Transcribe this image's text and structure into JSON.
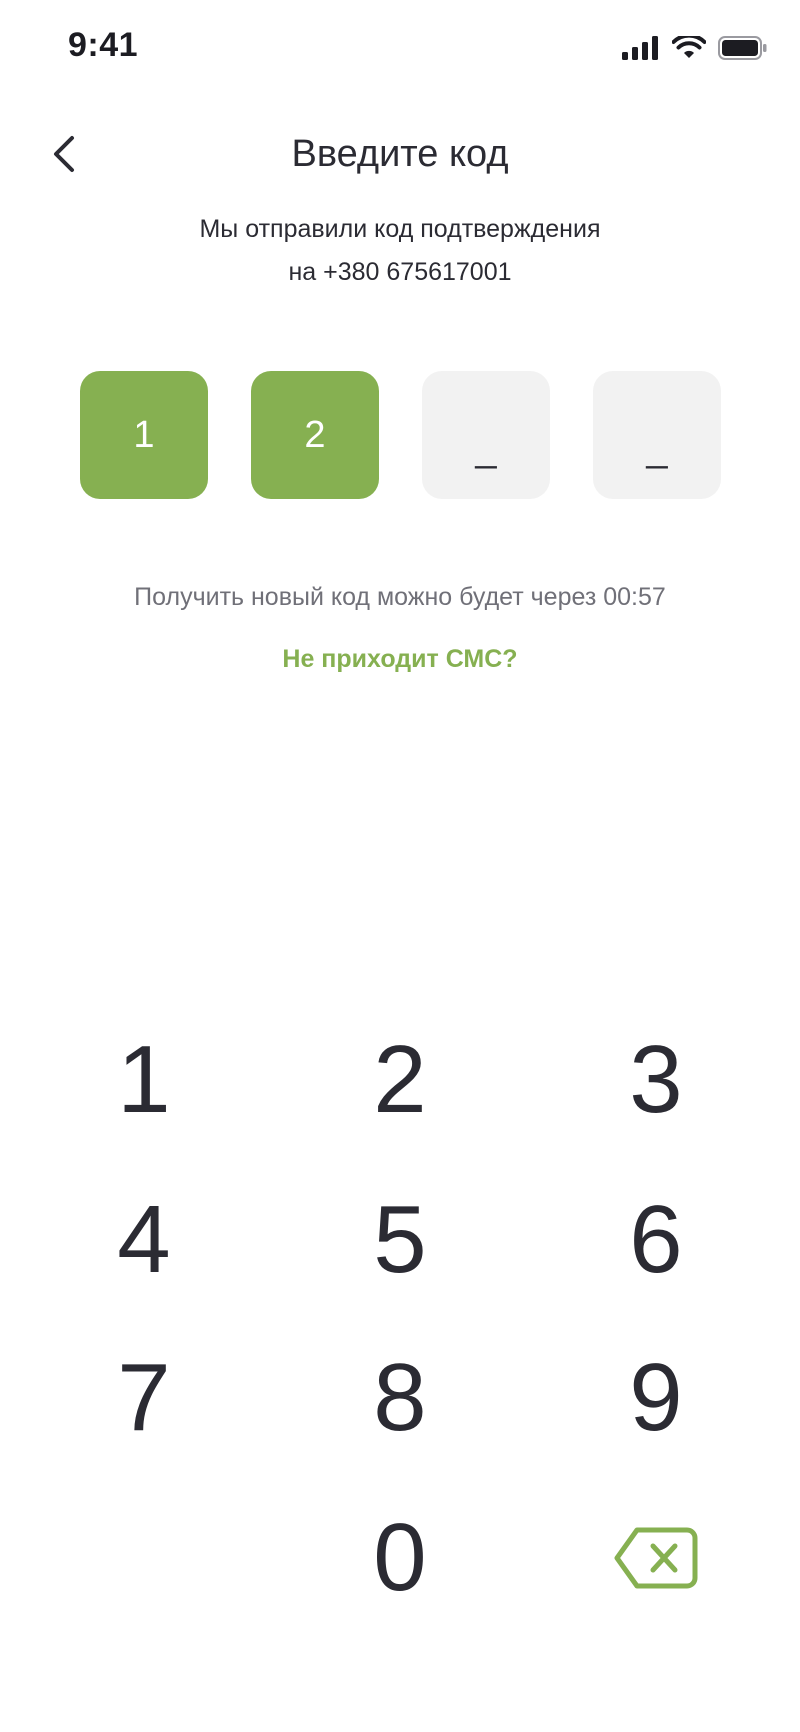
{
  "status_bar": {
    "time": "9:41",
    "icons": [
      "signal-icon",
      "wifi-icon",
      "battery-icon"
    ]
  },
  "header": {
    "back_icon": "chevron-left-icon",
    "title": "Введите код"
  },
  "subtitle": {
    "line1": "Мы отправили код подтверждения",
    "line2": "на +380 675617001"
  },
  "code_boxes": [
    {
      "value": "1",
      "state": "filled"
    },
    {
      "value": "2",
      "state": "filled"
    },
    {
      "value": "_",
      "state": "empty"
    },
    {
      "value": "_",
      "state": "empty"
    }
  ],
  "timer_text": "Получить новый код можно будет через 00:57",
  "no_sms_link": "Не приходит СМС?",
  "keypad": {
    "keys": [
      "1",
      "2",
      "3",
      "4",
      "5",
      "6",
      "7",
      "8",
      "9",
      "0"
    ],
    "delete_icon": "backspace-icon"
  },
  "colors": {
    "accent": "#86b051",
    "empty_box": "#f2f2f2",
    "text": "#2b2b33",
    "muted_text": "#707078"
  }
}
